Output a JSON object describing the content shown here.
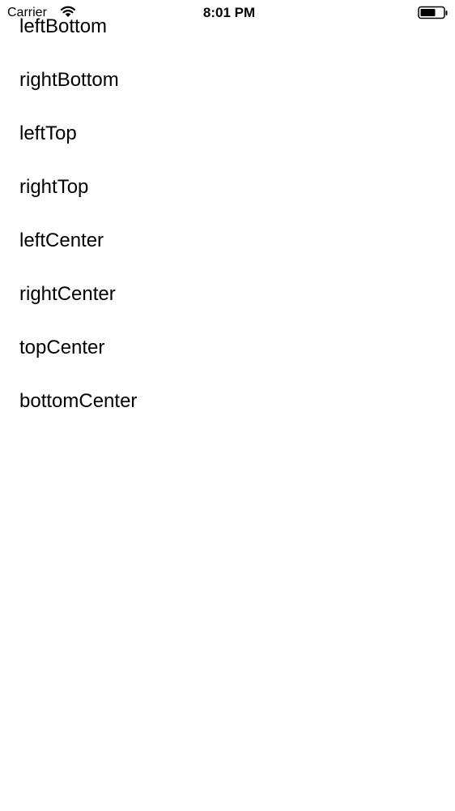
{
  "status_bar": {
    "carrier": "Carrier",
    "time": "8:01 PM",
    "signal_icon": "wifi-icon",
    "battery_icon": "battery-icon"
  },
  "list": {
    "items": [
      {
        "label": "leftBottom"
      },
      {
        "label": "rightBottom"
      },
      {
        "label": "leftTop"
      },
      {
        "label": "rightTop"
      },
      {
        "label": "leftCenter"
      },
      {
        "label": "rightCenter"
      },
      {
        "label": "topCenter"
      },
      {
        "label": "bottomCenter"
      }
    ]
  }
}
